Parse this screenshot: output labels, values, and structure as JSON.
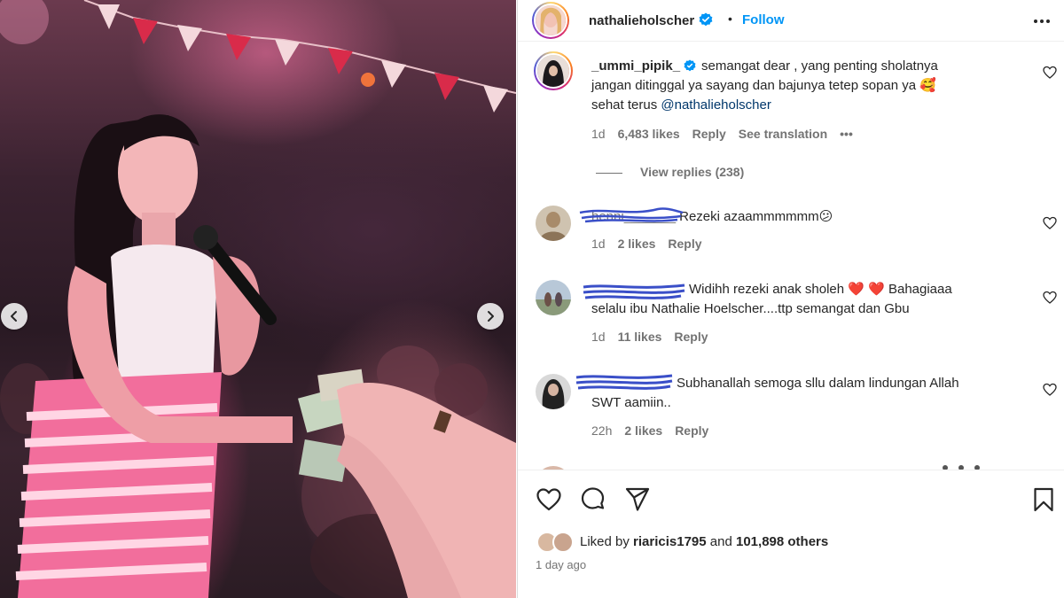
{
  "header": {
    "username": "nathalieholscher",
    "separator": "•",
    "follow_label": "Follow"
  },
  "comments": [
    {
      "username": "_ummi_pipik_",
      "verified": true,
      "text_line1": "semangat dear , yang penting sholatnya",
      "text_line2": "jangan ditinggal ya sayang dan bajunya tetep sopan ya",
      "text_line3_prefix": "sehat terus ",
      "mention": "@nathalieholscher",
      "time": "1d",
      "likes": "6,483 likes",
      "reply": "Reply",
      "translate": "See translation",
      "more": "•••",
      "view_replies": "View replies (238)"
    },
    {
      "username_redacted": "henni_______",
      "text": "Rezeki azaammmmmm",
      "emoji": "😕",
      "time": "1d",
      "likes": "2 likes",
      "reply": "Reply"
    },
    {
      "text_line1": "Widihh rezeki anak sholeh",
      "emoji": "❤️ ❤️",
      "text_line1_suffix": "Bahagiaaa",
      "text_line2": "selalu ibu Nathalie Hoelscher....ttp semangat dan Gbu",
      "time": "1d",
      "likes": "11 likes",
      "reply": "Reply"
    },
    {
      "text_line1": "Subhanallah semoga sllu dalam lindungan Allah",
      "text_line2": "SWT aamiin..",
      "time": "22h",
      "likes": "2 likes",
      "reply": "Reply"
    }
  ],
  "likes": {
    "prefix": "Liked by ",
    "user": "riaricis1795",
    "middle": " and ",
    "count": "101,898 others"
  },
  "timestamp": "1 day ago",
  "icons": [
    "heart-icon",
    "comment-icon",
    "share-icon",
    "bookmark-icon",
    "more-icon",
    "verified-icon",
    "chevron-left-icon",
    "chevron-right-icon"
  ],
  "colors": {
    "link": "#0095f6",
    "verified": "#0095f6",
    "meta": "#737373",
    "heart_red": "#e0243a"
  }
}
